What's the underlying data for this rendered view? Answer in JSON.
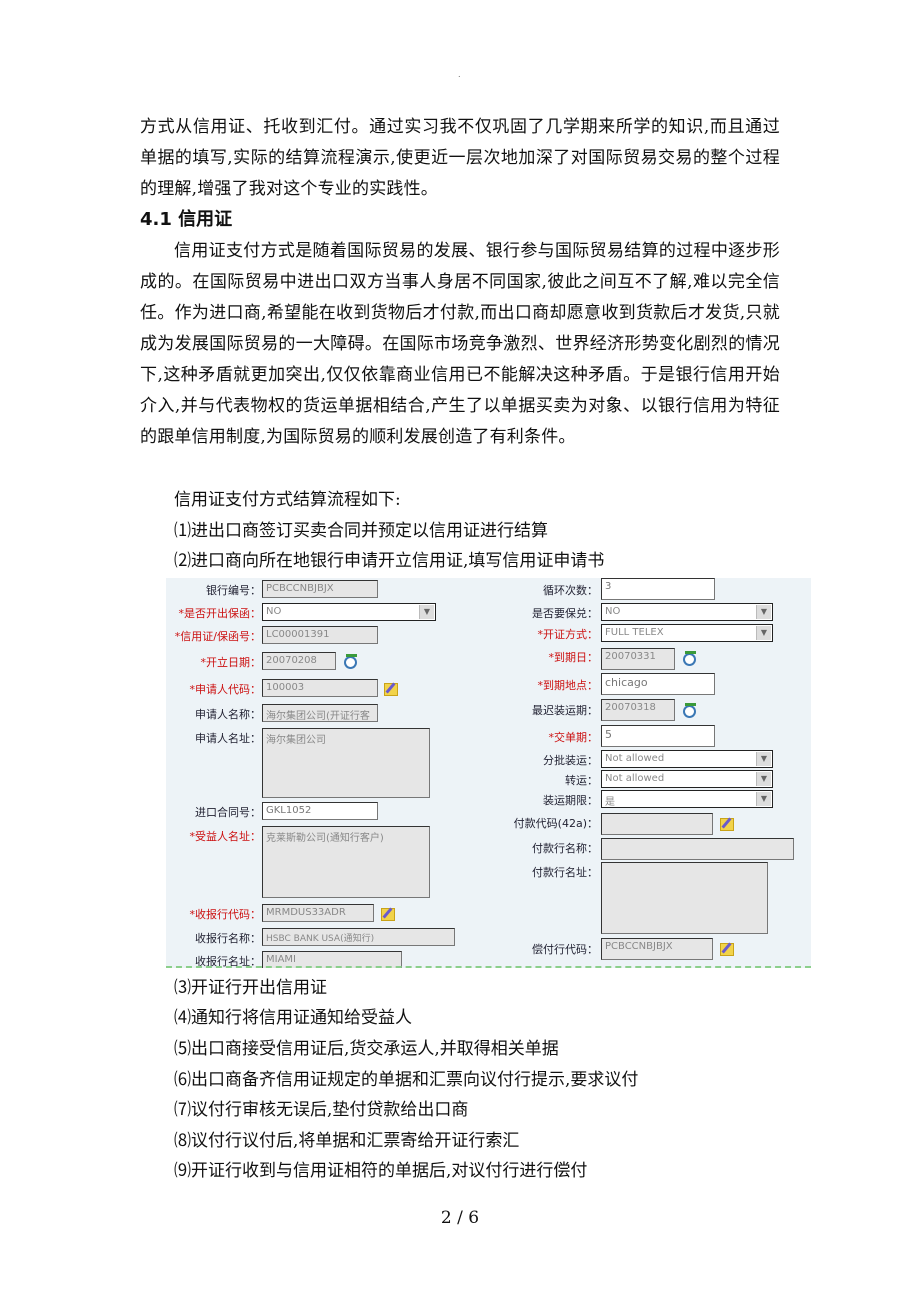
{
  "document": {
    "page_marker": ".",
    "intro_paragraph": "方式从信用证、托收到汇付。通过实习我不仅巩固了几学期来所学的知识,而且通过单据的填写,实际的结算流程演示,使更近一层次地加深了对国际贸易交易的整个过程的理解,增强了我对这个专业的实践性。",
    "section_heading": "4.1 信用证",
    "section_paragraph": "信用证支付方式是随着国际贸易的发展、银行参与国际贸易结算的过程中逐步形成的。在国际贸易中进出口双方当事人身居不同国家,彼此之间互不了解,难以完全信任。作为进口商,希望能在收到货物后才付款,而出口商却愿意收到货款后才发货,只就成为发展国际贸易的一大障碍。在国际市场竞争激烈、世界经济形势变化剧烈的情况下,这种矛盾就更加突出,仅仅依靠商业信用已不能解决这种矛盾。于是银行信用开始介入,并与代表物权的货运单据相结合,产生了以单据买卖为对象、以银行信用为特征的跟单信用制度,为国际贸易的顺利发展创造了有利条件。",
    "flow_intro": "信用证支付方式结算流程如下:",
    "steps_before_form": [
      "⑴进出口商签订买卖合同并预定以信用证进行结算",
      "⑵进口商向所在地银行申请开立信用证,填写信用证申请书"
    ],
    "steps_after_form": [
      "⑶开证行开出信用证",
      "⑷通知行将信用证通知给受益人",
      "⑸出口商接受信用证后,货交承运人,并取得相关单据",
      "⑹出口商备齐信用证规定的单据和汇票向议付行提示,要求议付",
      "⑺议付行审核无误后,垫付贷款给出口商",
      "⑻议付行议付后,将单据和汇票寄给开证行索汇",
      "⑼开证行收到与信用证相符的单据后,对议付行进行偿付"
    ],
    "page_number": "2 / 6"
  },
  "form": {
    "left": {
      "bank_code": {
        "label": "银行编号：",
        "value": "PCBCCNBJBJX"
      },
      "issue_guarantee": {
        "label": "*是否开出保函：",
        "value": "NO"
      },
      "lc_number": {
        "label": "*信用证/保函号：",
        "value": "LC00001391"
      },
      "issue_date": {
        "label": "*开立日期：",
        "value": "20070208"
      },
      "applicant_code": {
        "label": "*申请人代码：",
        "value": "100003"
      },
      "applicant_name": {
        "label": "申请人名称：",
        "value": "海尔集团公司(开证行客"
      },
      "applicant_address": {
        "label": "申请人名址：",
        "value": "海尔集团公司"
      },
      "import_contract_no": {
        "label": "进口合同号：",
        "value": "GKL1052"
      },
      "beneficiary_address": {
        "label": "*受益人名址：",
        "value": "克莱斯勒公司(通知行客户)"
      },
      "receiving_bank_code": {
        "label": "*收报行代码：",
        "value": "MRMDUS33ADR"
      },
      "receiving_bank_name": {
        "label": "收报行名称：",
        "value": "HSBC BANK USA(通知行)"
      },
      "receiving_bank_address": {
        "label": "收报行名址：",
        "value": "MIAMI"
      }
    },
    "right": {
      "revolving_times": {
        "label": "循环次数：",
        "value": "3"
      },
      "require_confirmation": {
        "label": "是否要保兑：",
        "value": "NO"
      },
      "issue_method": {
        "label": "*开证方式：",
        "value": "FULL TELEX"
      },
      "expiry_date": {
        "label": "*到期日：",
        "value": "20070331"
      },
      "expiry_place": {
        "label": "*到期地点：",
        "value": "chicago"
      },
      "latest_shipment": {
        "label": "最迟装运期：",
        "value": "20070318"
      },
      "presentation_period": {
        "label": "*交单期：",
        "value": "5"
      },
      "partial_shipment": {
        "label": "分批装运：",
        "value": "Not allowed"
      },
      "transshipment": {
        "label": "转运：",
        "value": "Not allowed"
      },
      "shipment_period": {
        "label": "装运期限：",
        "value": "是"
      },
      "payer_code": {
        "label": "付款代码(42a)：",
        "value": ""
      },
      "payer_bank_name": {
        "label": "付款行名称：",
        "value": ""
      },
      "payer_bank_address": {
        "label": "付款行名址：",
        "value": ""
      },
      "reimbursing_bank_code": {
        "label": "偿付行代码：",
        "value": "PCBCCNBJBJX"
      }
    },
    "colors": {
      "background": "#edf3f7",
      "required_label": "#cc1111",
      "label": "#223",
      "dashed_border": "#8ccf8c"
    }
  }
}
